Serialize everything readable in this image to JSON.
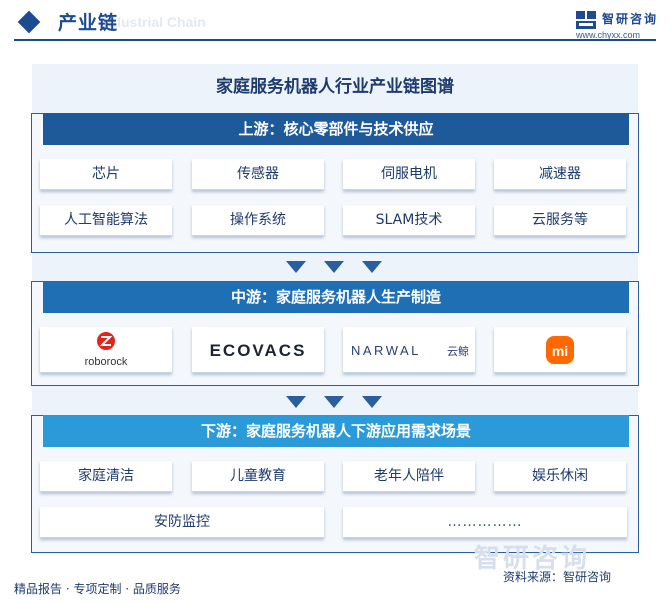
{
  "header": {
    "title": "产业链",
    "subtitle_en": "Industrial Chain",
    "logo_name": "智研咨询",
    "logo_url": "www.chyxx.com"
  },
  "panel_title": "家庭服务机器人行业产业链图谱",
  "upstream": {
    "title": "上游：核心零部件与技术供应",
    "items": [
      "芯片",
      "传感器",
      "伺服电机",
      "减速器",
      "人工智能算法",
      "操作系统",
      "SLAM技术",
      "云服务等"
    ]
  },
  "midstream": {
    "title": "中游：家庭服务机器人生产制造",
    "brands": [
      {
        "name": "roborock",
        "icon": "roborock-logo"
      },
      {
        "name": "ECOVACS",
        "icon": "ecovacs-logo"
      },
      {
        "name": "NARWAL",
        "extra": "云鲸",
        "icon": "narwal-logo"
      },
      {
        "name": "mi",
        "icon": "xiaomi-logo"
      }
    ]
  },
  "downstream": {
    "title": "下游：家庭服务机器人下游应用需求场景",
    "items": [
      "家庭清洁",
      "儿童教育",
      "老年人陪伴",
      "娱乐休闲",
      "安防监控",
      "……………"
    ]
  },
  "footer": {
    "left": "精品报告 · 专项定制 · 品质服务",
    "source": "资料来源：智研咨询",
    "watermark": "智研咨询"
  },
  "colors": {
    "brand_blue": "#1e4a8f",
    "up_head": "#1e5a9a",
    "mid_head": "#1f6fb4",
    "down_head": "#2a9bd8",
    "xiaomi_orange": "#ff6900",
    "roborock_red": "#e2231a"
  }
}
